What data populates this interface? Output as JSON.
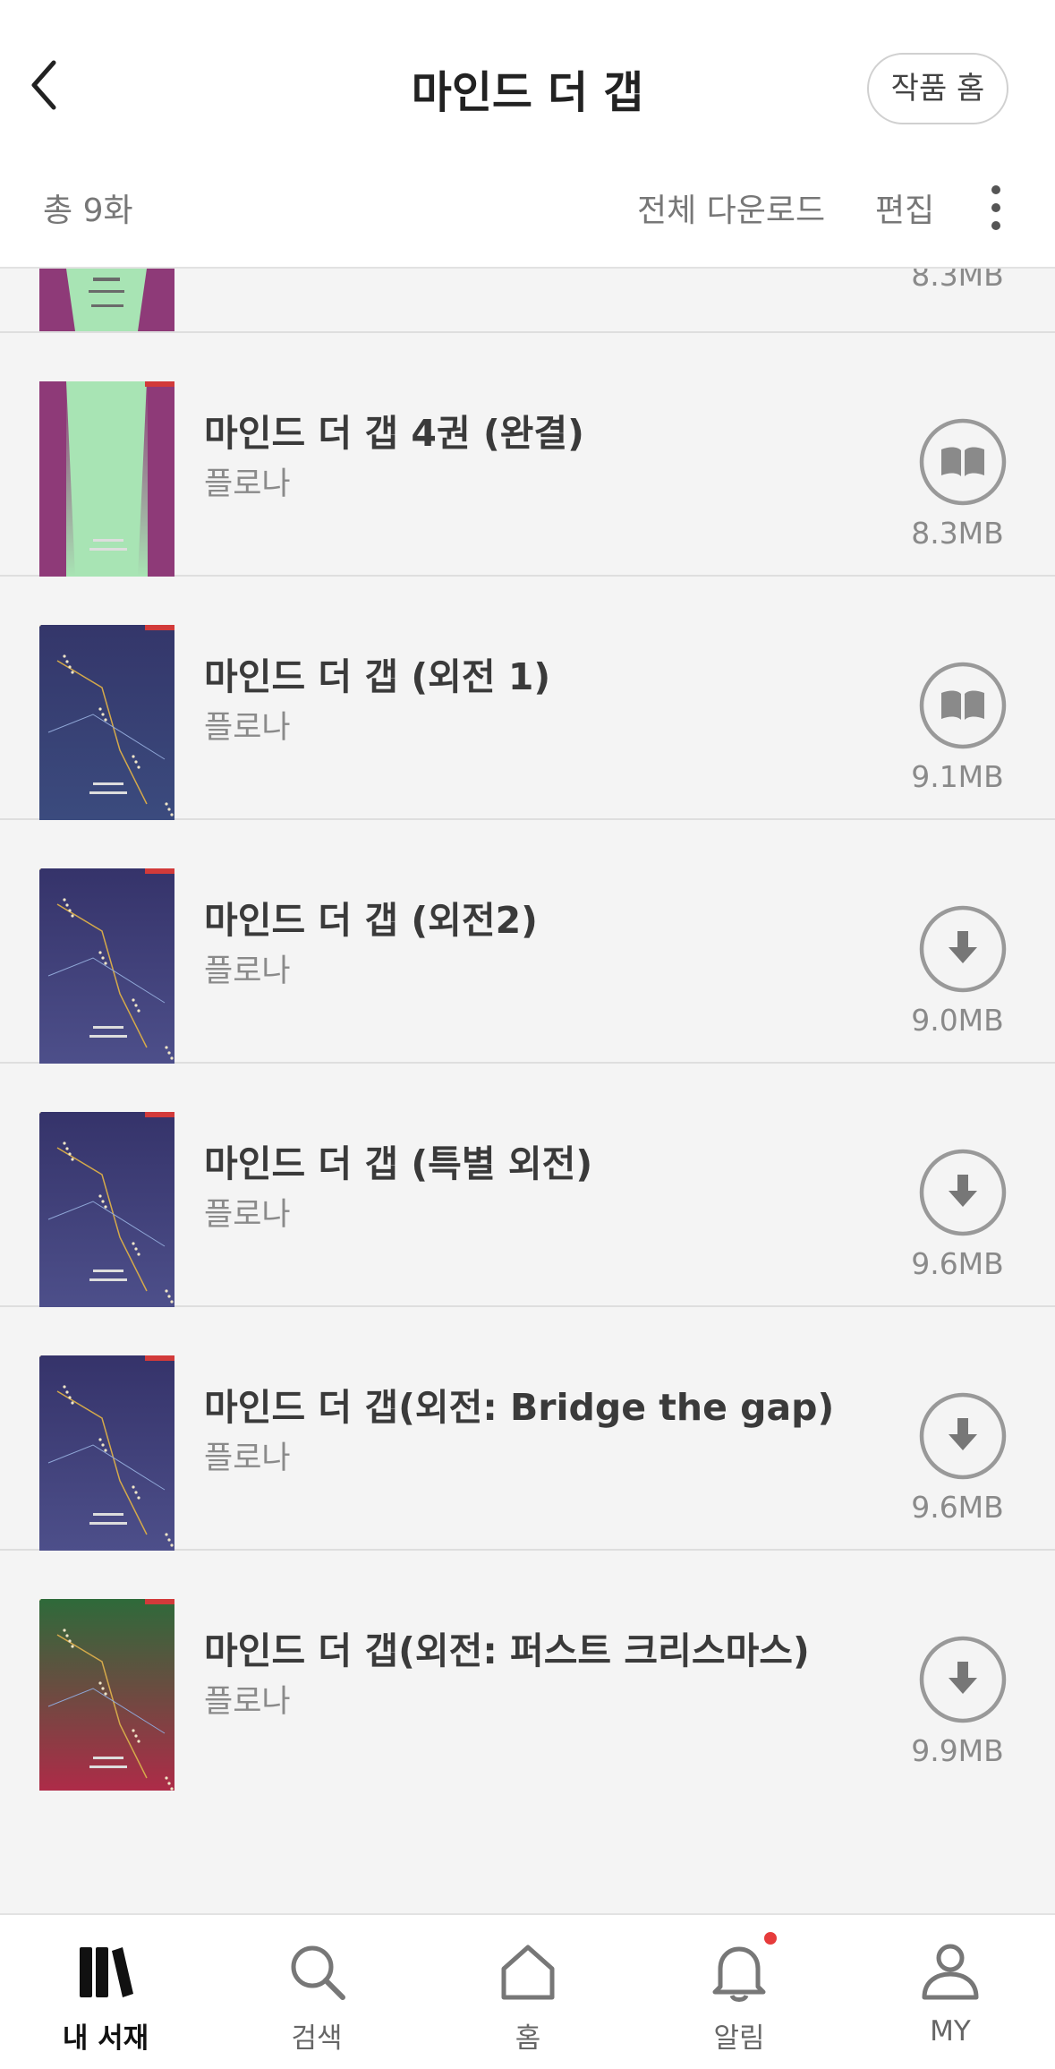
{
  "header": {
    "title": "마인드 더 갭",
    "home_button": "작품 홈",
    "count_label": "총 9화",
    "download_all": "전체 다운로드",
    "edit": "편집"
  },
  "partial_item": {
    "size": "8.3MB"
  },
  "episodes": [
    {
      "title": "마인드 더 갭 4권 (완결)",
      "author": "플로나",
      "size": "8.3MB",
      "action": "read-icon",
      "cover_colors": [
        "#8e3a78",
        "#a8e4b4"
      ]
    },
    {
      "title": "마인드 더 갭 (외전 1)",
      "author": "플로나",
      "size": "9.1MB",
      "action": "read-icon",
      "cover_colors": [
        "#34366a",
        "#3b4b7e"
      ]
    },
    {
      "title": "마인드 더 갭 (외전2)",
      "author": "플로나",
      "size": "9.0MB",
      "action": "download-icon",
      "cover_colors": [
        "#35336a",
        "#4d4f8a"
      ]
    },
    {
      "title": "마인드 더 갭 (특별 외전)",
      "author": "플로나",
      "size": "9.6MB",
      "action": "download-icon",
      "cover_colors": [
        "#35336a",
        "#4d4f8a"
      ]
    },
    {
      "title": "마인드 더 갭(외전: Bridge the gap)",
      "author": "플로나",
      "size": "9.6MB",
      "action": "download-icon",
      "cover_colors": [
        "#35336a",
        "#4d4f8a"
      ]
    },
    {
      "title": "마인드 더 갭(외전: 퍼스트 크리스마스)",
      "author": "플로나",
      "size": "9.9MB",
      "action": "download-icon",
      "cover_colors": [
        "#2e6a3a",
        "#b02a48"
      ]
    }
  ],
  "tabs": [
    {
      "label": "내 서재",
      "icon": "library-icon",
      "active": true
    },
    {
      "label": "검색",
      "icon": "search-icon",
      "active": false
    },
    {
      "label": "홈",
      "icon": "home-icon",
      "active": false
    },
    {
      "label": "알림",
      "icon": "bell-icon",
      "active": false
    },
    {
      "label": "MY",
      "icon": "person-icon",
      "active": false
    }
  ],
  "colors": {
    "accent_dot": "#e63b3b",
    "text_primary": "#3a3a3a",
    "text_secondary": "#8a8a8a"
  }
}
